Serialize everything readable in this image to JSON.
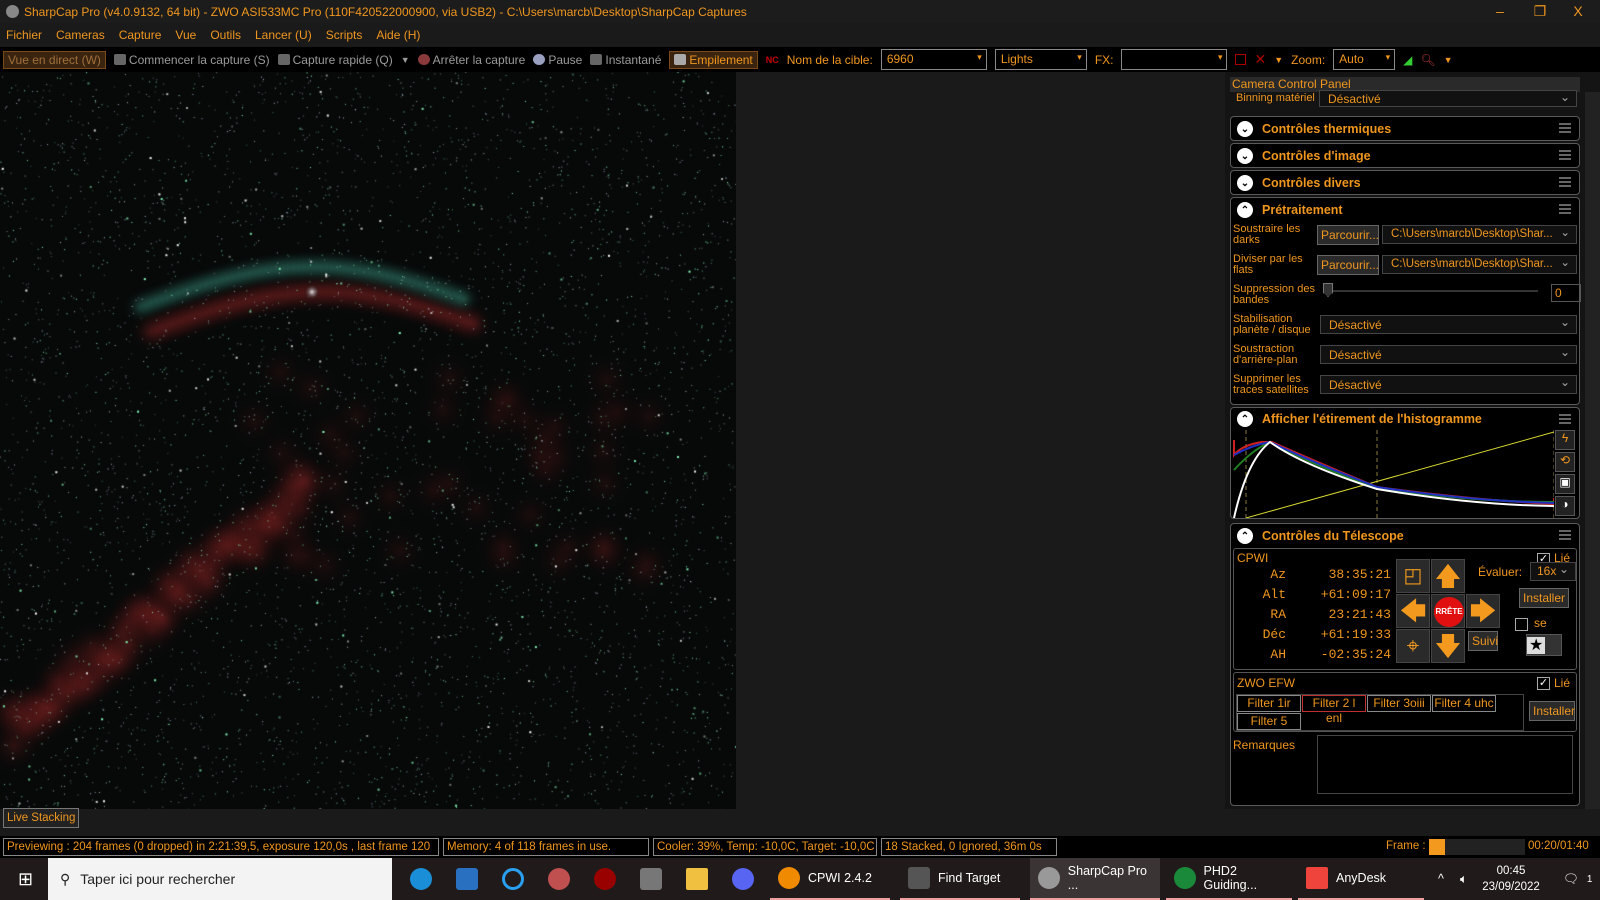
{
  "window": {
    "title": "SharpCap Pro (v4.0.9132, 64 bit) - ZWO ASI533MC Pro (110F420522000900, via USB2) - C:\\Users\\marcb\\Desktop\\SharpCap Captures",
    "minimize": "–",
    "maximize": "❐",
    "close": "X"
  },
  "menu": [
    "Fichier",
    "Cameras",
    "Capture",
    "Vue",
    "Outils",
    "Lancer (U)",
    "Scripts",
    "Aide (H)"
  ],
  "toolbar": {
    "live_view": "Vue en direct (W)",
    "start_capture": "Commencer la capture (S)",
    "quick_capture": "Capture rapide (Q)",
    "stop_capture": "Arrêter la capture",
    "pause": "Pause",
    "snapshot": "Instantané",
    "stacking": "Empilement",
    "target_label": "Nom de la cible:",
    "target_value": "6960",
    "frame_type": "Lights",
    "fx_label": "FX:",
    "fx_value": "",
    "zoom_label": "Zoom:",
    "zoom_value": "Auto"
  },
  "panel": {
    "title": "Camera Control Panel",
    "binning": {
      "label": "Binning matériel",
      "value": "Désactivé"
    },
    "sections_collapsed": [
      "Contrôles thermiques",
      "Contrôles d'image",
      "Contrôles divers"
    ],
    "preprocessing": {
      "title": "Prétraitement",
      "darks": {
        "label": "Soustraire les darks",
        "button": "Parcourir...",
        "value": "C:\\Users\\marcb\\Desktop\\Shar..."
      },
      "flats": {
        "label": "Diviser par les flats",
        "button": "Parcourir...",
        "value": "C:\\Users\\marcb\\Desktop\\Shar..."
      },
      "banding": {
        "label": "Suppression des bandes",
        "value": "0",
        "level": 0
      },
      "stabilization": {
        "label": "Stabilisation planète / disque",
        "value": "Désactivé"
      },
      "background": {
        "label": "Soustraction d'arrière-plan",
        "value": "Désactivé"
      },
      "satellites": {
        "label": "Supprimer les traces satellites",
        "value": "Désactivé"
      }
    },
    "histogram": {
      "title": "Afficher l'étirement de l'histogramme"
    },
    "telescope": {
      "title": "Contrôles du Télescope",
      "mount": "CPWI",
      "linked_label": "Lié",
      "linked": true,
      "coords": [
        {
          "label": "Az",
          "value": "38:35:21"
        },
        {
          "label": "Alt",
          "value": "+61:09:17"
        },
        {
          "label": "RA",
          "value": "23:21:43"
        },
        {
          "label": "Déc",
          "value": "+61:19:33"
        },
        {
          "label": "AH",
          "value": "-02:35:24"
        }
      ],
      "stop": "RRÊTE",
      "rate_label": "Évaluer:",
      "rate": "16x",
      "setup": "Installer",
      "park_label": "se garer",
      "tracking": "Suivi"
    },
    "efw": {
      "title": "ZWO EFW",
      "linked_label": "Lié",
      "filters": [
        "Filter 1ir",
        "Filter 2 l enl",
        "Filter 3oiii",
        "Filter 4 uhc",
        "Filter 5"
      ],
      "selected": 1,
      "setup": "Installer"
    },
    "notes_label": "Remarques"
  },
  "mode_tab": "Live Stacking",
  "status": {
    "preview": "Previewing : 204 frames (0 dropped) in 2:21:39,5, exposure 120,0s , last frame 120",
    "memory": "Memory: 4 of 118 frames in use.",
    "cooler": "Cooler: 39%, Temp: -10,0C, Target: -10,0C",
    "stack": "18 Stacked, 0 Ignored, 36m 0s",
    "frame_label": "Frame :",
    "frame_progress": 0.17,
    "frame_time": "00:20/01:40"
  },
  "taskbar": {
    "search": "Taper ici pour rechercher",
    "apps": [
      "CPWI 2.4.2",
      "Find Target",
      "SharpCap Pro ...",
      "PHD2 Guiding...",
      "AnyDesk"
    ],
    "time": "00:45",
    "date": "23/09/2022",
    "notifications": "1"
  }
}
